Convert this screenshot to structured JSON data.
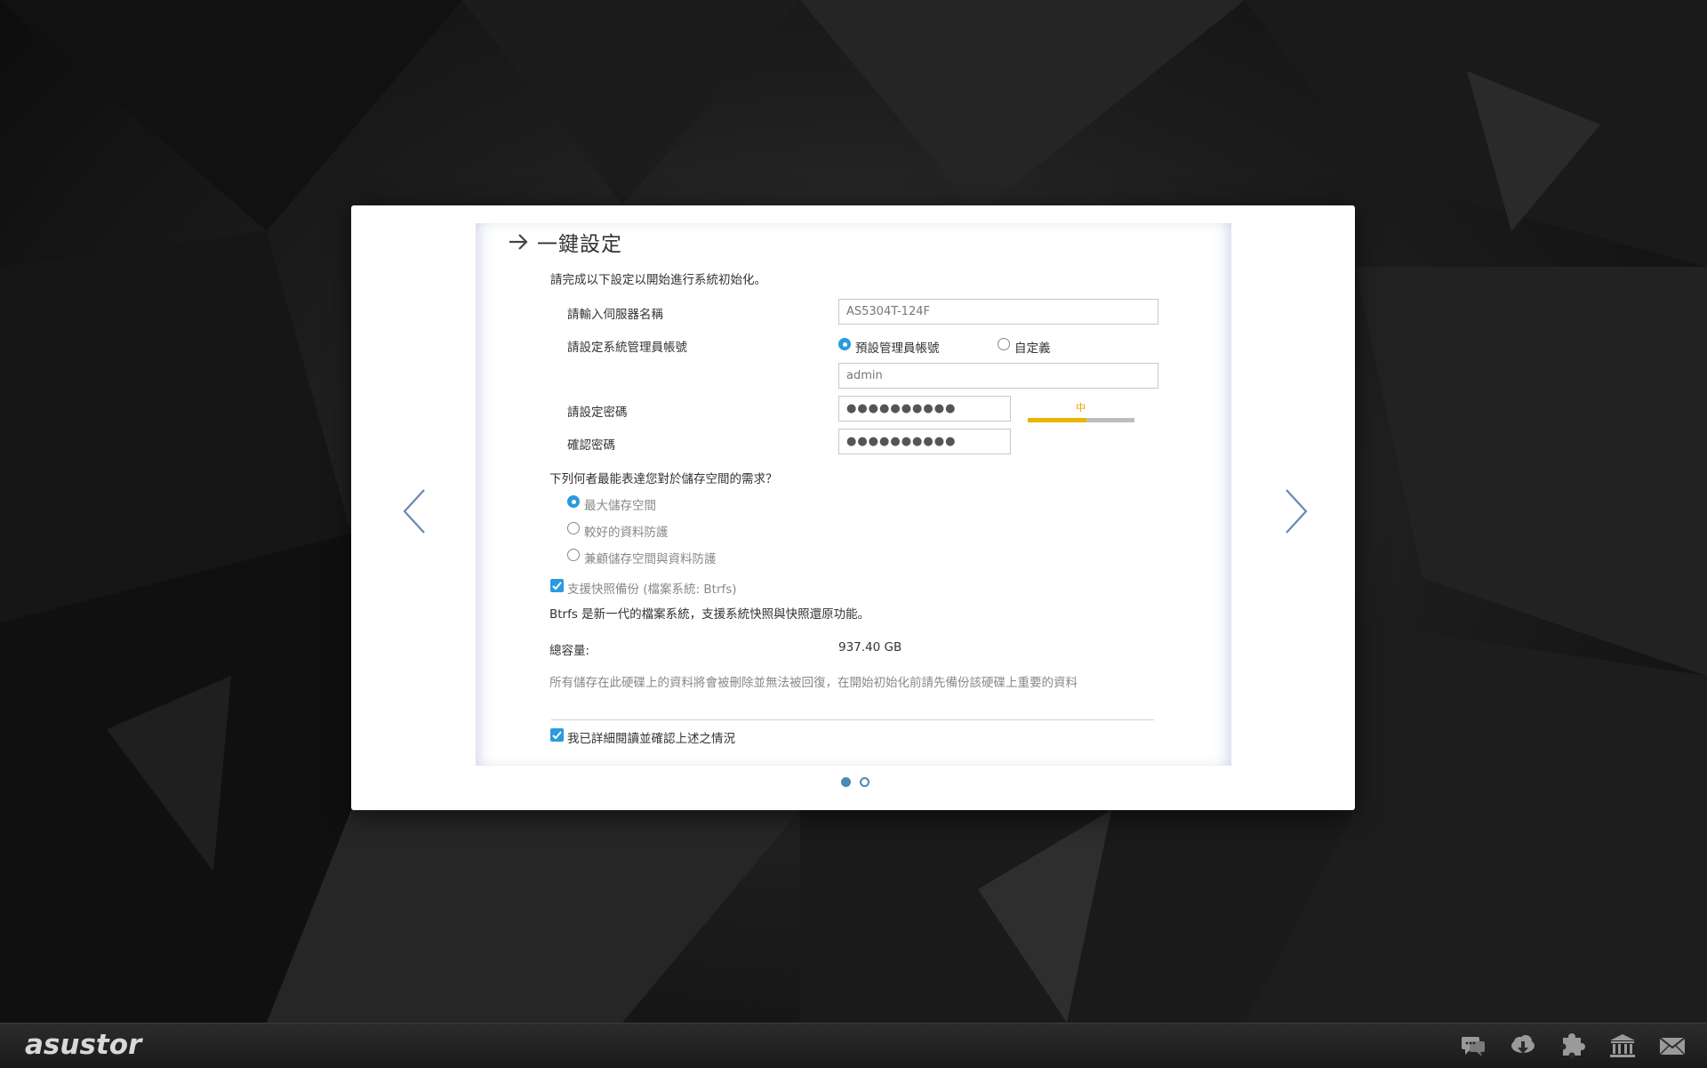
{
  "wizard": {
    "title": "一鍵設定",
    "intro": "請完成以下設定以開始進行系統初始化。",
    "server_name_label": "請輸入伺服器名稱",
    "server_name_value": "AS5304T-124F",
    "admin_account_label": "請設定系統管理員帳號",
    "admin_option_default": "預設管理員帳號",
    "admin_option_custom": "自定義",
    "admin_value": "admin",
    "password_label": "請設定密碼",
    "password_value": "●●●●●●●●●●",
    "password_strength_label": "中",
    "password_strength_level": 0.55,
    "confirm_label": "確認密碼",
    "confirm_value": "●●●●●●●●●●",
    "storage_question": "下列何者最能表達您對於儲存空間的需求？",
    "storage_options": [
      "最大儲存空間",
      "較好的資料防護",
      "兼顧儲存空間與資料防護"
    ],
    "snapshot_label": "支援快照備份 (檔案系統: Btrfs)",
    "btrfs_note": "Btrfs 是新一代的檔案系統，支援系統快照與快照還原功能。",
    "total_capacity_label": "總容量:",
    "total_capacity_value": "937.40 GB",
    "warning_text": "所有儲存在此硬碟上的資料將會被刪除並無法被回復，在開始初始化前請先備份該硬碟上重要的資料",
    "confirm_read_label": "我已詳細閱讀並確認上述之情況",
    "page_index": 1,
    "page_count": 2
  },
  "taskbar": {
    "logo_text": "asustor",
    "icons": [
      "chat-icon",
      "cloud-download-icon",
      "puzzle-icon",
      "bank-icon",
      "mail-icon"
    ]
  },
  "colors": {
    "accent": "#2a9bdc",
    "strength": "#e8b400",
    "nav_arrow": "#6a86b8"
  }
}
